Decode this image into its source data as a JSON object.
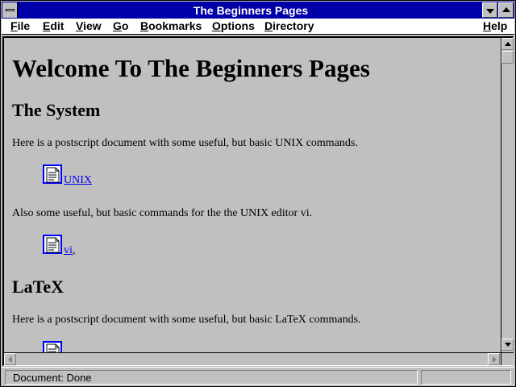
{
  "window": {
    "title": "The Beginners Pages",
    "system_menu_icon": "window-menu-icon",
    "minimize_icon": "minimize-arrow-icon",
    "maximize_icon": "maximize-arrow-icon"
  },
  "menubar": {
    "items": [
      {
        "key": "F",
        "rest": "ile"
      },
      {
        "key": "E",
        "rest": "dit"
      },
      {
        "key": "V",
        "rest": "iew"
      },
      {
        "key": "G",
        "rest": "o"
      },
      {
        "key": "B",
        "rest": "ookmarks"
      },
      {
        "key": "O",
        "rest": "ptions"
      },
      {
        "key": "D",
        "rest": "irectory"
      },
      {
        "key": "H",
        "rest": "elp"
      }
    ]
  },
  "page": {
    "title": "Welcome To The Beginners Pages",
    "sections": [
      {
        "heading": "The System",
        "text": "Here is a postscript document with some useful, but basic UNIX commands.",
        "link": " UNIX",
        "link_suffix": ""
      },
      {
        "heading": "",
        "text": "Also some useful, but basic commands for the the UNIX editor vi.",
        "link": " vi",
        "link_suffix": ","
      },
      {
        "heading": "LaTeX",
        "text": "Here is a postscript document with some useful, but basic LaTeX commands.",
        "link": "",
        "link_suffix": ""
      }
    ],
    "link_icon": "document-icon",
    "link_color": "#0000ee",
    "background_color": "#c0c0c0"
  },
  "statusbar": {
    "text": "Document: Done"
  },
  "colors": {
    "titlebar": "#0000a8",
    "menubar": "#ffffff",
    "chrome": "#c0c0c0"
  }
}
